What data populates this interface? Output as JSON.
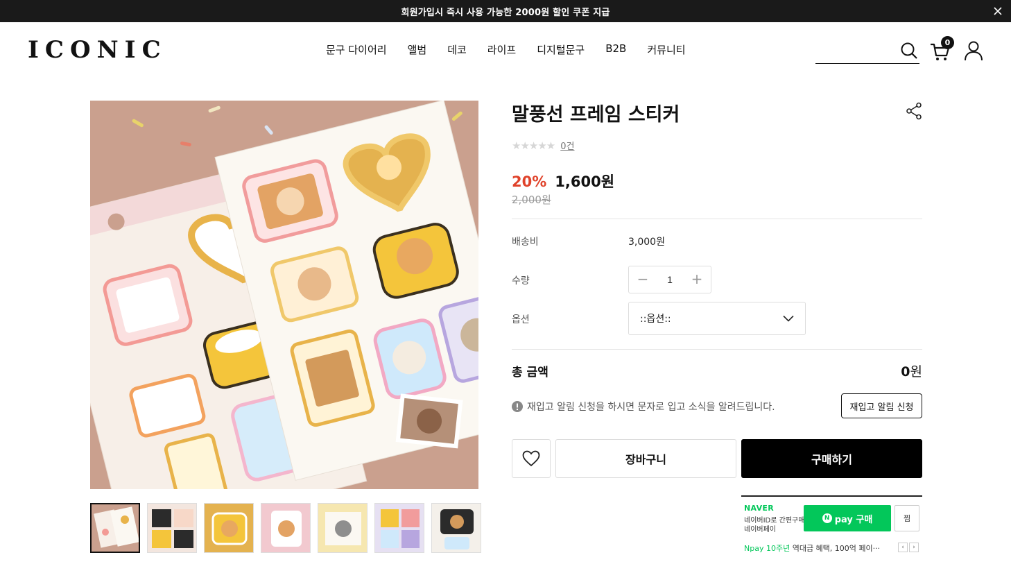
{
  "banner": {
    "message": "회원가입시 즉시 사용 가능한 2000원 할인 쿠폰 지급"
  },
  "header": {
    "logo": "ICONIC",
    "nav": [
      "문구 다이어리",
      "앨범",
      "데코",
      "라이프",
      "디지털문구",
      "B2B",
      "커뮤니티"
    ],
    "search_placeholder": "",
    "cart_count": "0"
  },
  "product": {
    "title": "말풍선 프레임 스티커",
    "stars": "★★★★★",
    "review_count": "0건",
    "discount": "20%",
    "price": "1,600원",
    "original_price": "2,000원",
    "shipping_label": "배송비",
    "shipping_value": "3,000원",
    "quantity_label": "수량",
    "quantity_value": "1",
    "option_label": "옵션",
    "option_selected": "::옵션::",
    "total_label": "총 금액",
    "total_value": "0",
    "total_unit": "원",
    "restock_notice": "재입고 알림 신청을 하시면 문자로 입고 소식을 알려드립니다.",
    "restock_button": "재입고 알림 신청",
    "cart_button": "장바구니",
    "buy_button": "구매하기"
  },
  "npay": {
    "brand": "NAVER",
    "desc1": "네이버ID로 간편구매",
    "desc2": "네이버페이",
    "pay_label": "pay 구매",
    "zzim_label": "찜",
    "promo_highlight": "Npay 10주년",
    "promo_text": " 역대급 혜택, 100억 페이···"
  },
  "colors": {
    "discount": "#e0432b",
    "npay_green": "#03c75a",
    "buy_bg": "#000000"
  }
}
